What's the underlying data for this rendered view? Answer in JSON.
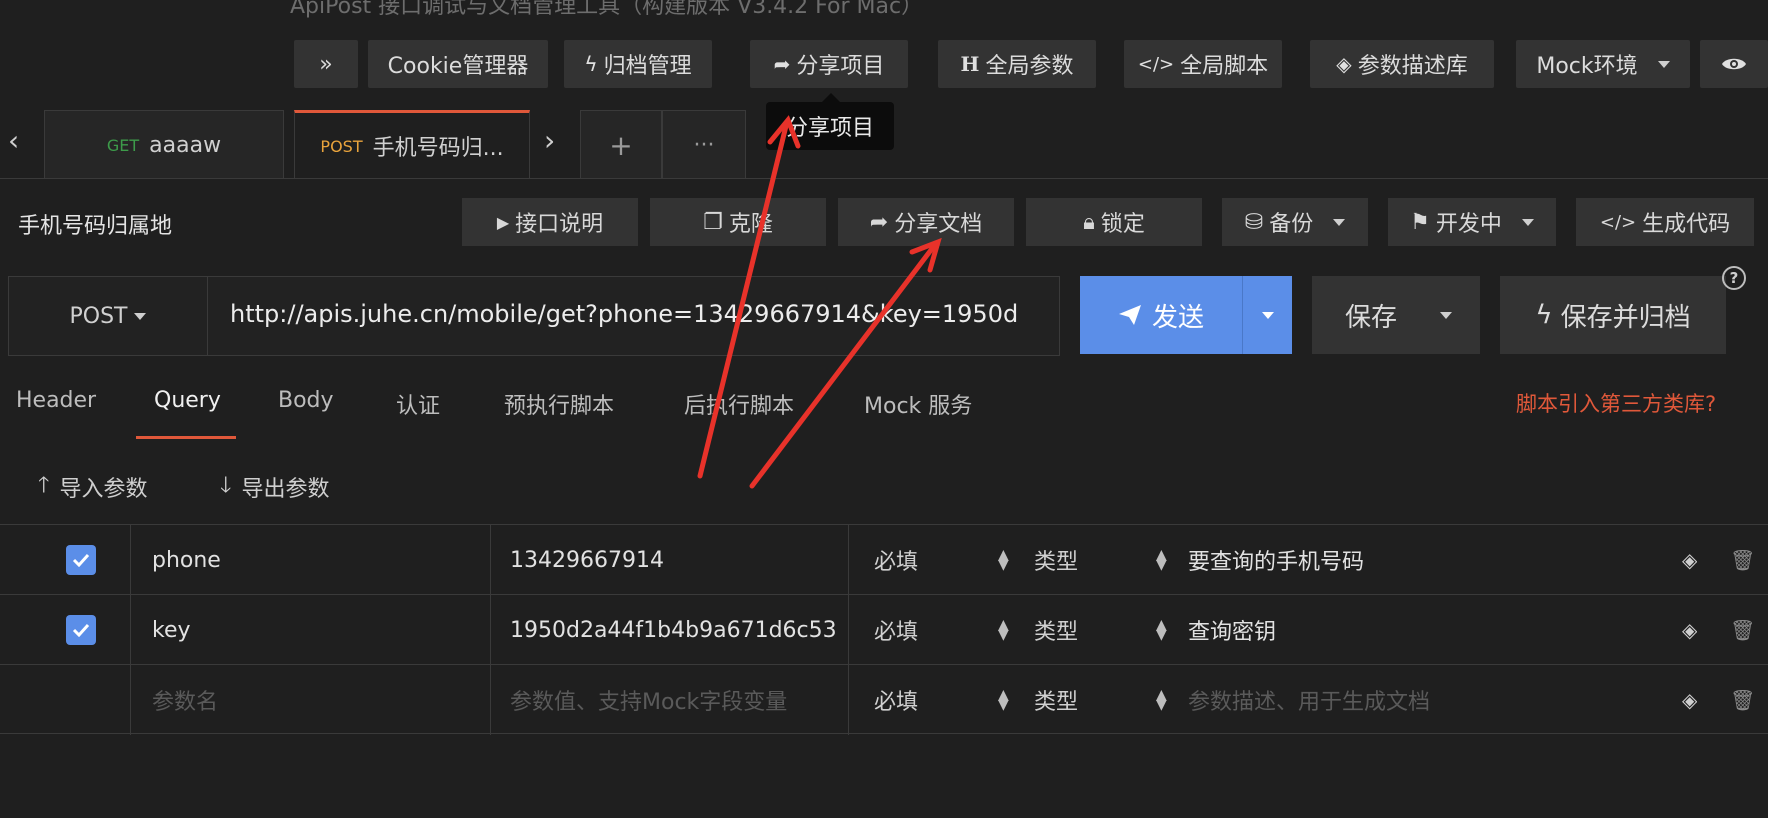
{
  "window": {
    "title": "ApiPost 接口调试与文档管理工具（构建版本 V3.4.2 For Mac）"
  },
  "topbar": {
    "expand_label": "»",
    "cookie_label": "Cookie管理器",
    "archive_label": "归档管理",
    "share_project_label": "分享项目",
    "global_params_label": "全局参数",
    "global_script_label": "全局脚本",
    "param_library_label": "参数描述库",
    "mock_env_label": "Mock环境",
    "tooltip_text": "分享项目"
  },
  "tabs": [
    {
      "method": "GET",
      "label": "aaaaw"
    },
    {
      "method": "POST",
      "label": "手机号码归..."
    }
  ],
  "tabbar": {
    "add_label": "+",
    "more_label": "···"
  },
  "request": {
    "title": "手机号码归属地",
    "doc_label": "接口说明",
    "clone_label": "克隆",
    "share_doc_label": "分享文档",
    "lock_label": "锁定",
    "backup_label": "备份",
    "status_label": "开发中",
    "gen_code_label": "生成代码",
    "method": "POST",
    "url": "http://apis.juhe.cn/mobile/get?phone=13429667914&key=1950d",
    "send_label": "发送",
    "save_label": "保存",
    "save_archive_label": "保存并归档",
    "help_label": "?"
  },
  "subtabs": {
    "items": [
      "Header",
      "Query",
      "Body",
      "认证",
      "预执行脚本",
      "后执行脚本",
      "Mock 服务"
    ],
    "active": "Query",
    "third_party_link": "脚本引入第三方类库?"
  },
  "param_actions": {
    "import_label": "导入参数",
    "export_label": "导出参数"
  },
  "params": {
    "rows": [
      {
        "checked": true,
        "name": "phone",
        "value": "13429667914",
        "required": "必填",
        "type": "类型",
        "desc": "要查询的手机号码"
      },
      {
        "checked": true,
        "name": "key",
        "value": "1950d2a44f1b4b9a671d6c53",
        "required": "必填",
        "type": "类型",
        "desc": "查询密钥"
      }
    ],
    "empty_row": {
      "name_placeholder": "参数名",
      "value_placeholder": "参数值、支持Mock字段变量",
      "required": "必填",
      "type": "类型",
      "desc_placeholder": "参数描述、用于生成文档"
    }
  },
  "colors": {
    "accent": "#e0583a",
    "primary": "#5b8ee8",
    "annotation": "#e8322a"
  }
}
